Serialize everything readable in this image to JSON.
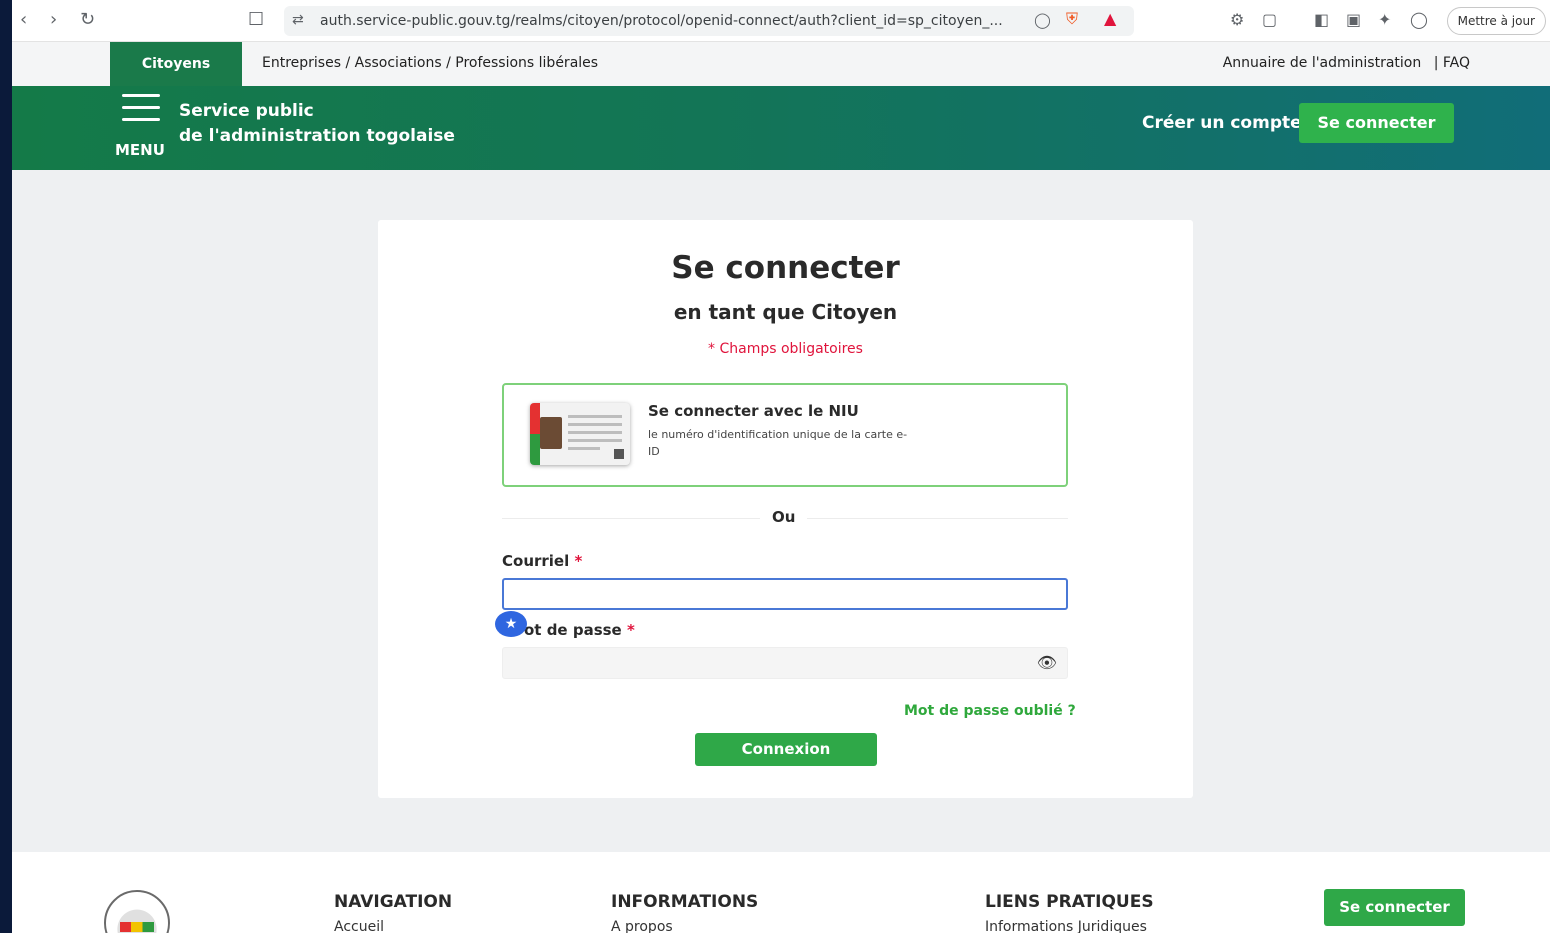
{
  "browser": {
    "url": "auth.service-public.gouv.tg/realms/citoyen/protocol/openid-connect/auth?client_id=sp_citoyen_...",
    "update_label": "Mettre à jour"
  },
  "topnav": {
    "citoyens": "Citoyens",
    "entreprises": "Entreprises / Associations / Professions libérales",
    "annuaire": "Annuaire de l'administration",
    "faq": "| FAQ"
  },
  "header": {
    "menu_label": "MENU",
    "brand_line1": "Service public",
    "brand_line2": "de l'administration togolaise",
    "create_account": "Créer un compte",
    "connect": "Se connecter"
  },
  "login": {
    "title": "Se connecter",
    "subtitle": "en tant que Citoyen",
    "required_note": "* Champs obligatoires",
    "niu_title": "Se connecter avec le NIU",
    "niu_desc": "le numéro d'identification unique de la carte e-ID",
    "separator": "Ou",
    "email_label": "Courriel",
    "password_label": "ot de passe",
    "required_star": "*",
    "email_value": "",
    "password_value": "",
    "forgot": "Mot de passe oublié ?",
    "submit": "Connexion"
  },
  "footer": {
    "navigation": "NAVIGATION",
    "navigation_link": "Accueil",
    "informations": "INFORMATIONS",
    "informations_link": "A propos",
    "liens": "LIENS PRATIQUES",
    "liens_link": "Informations Juridiques",
    "connect": "Se connecter"
  },
  "colors": {
    "brand_green": "#1a7a4a",
    "button_green": "#2fa848",
    "required_red": "#e0143c",
    "focus_blue": "#4a78d6"
  }
}
